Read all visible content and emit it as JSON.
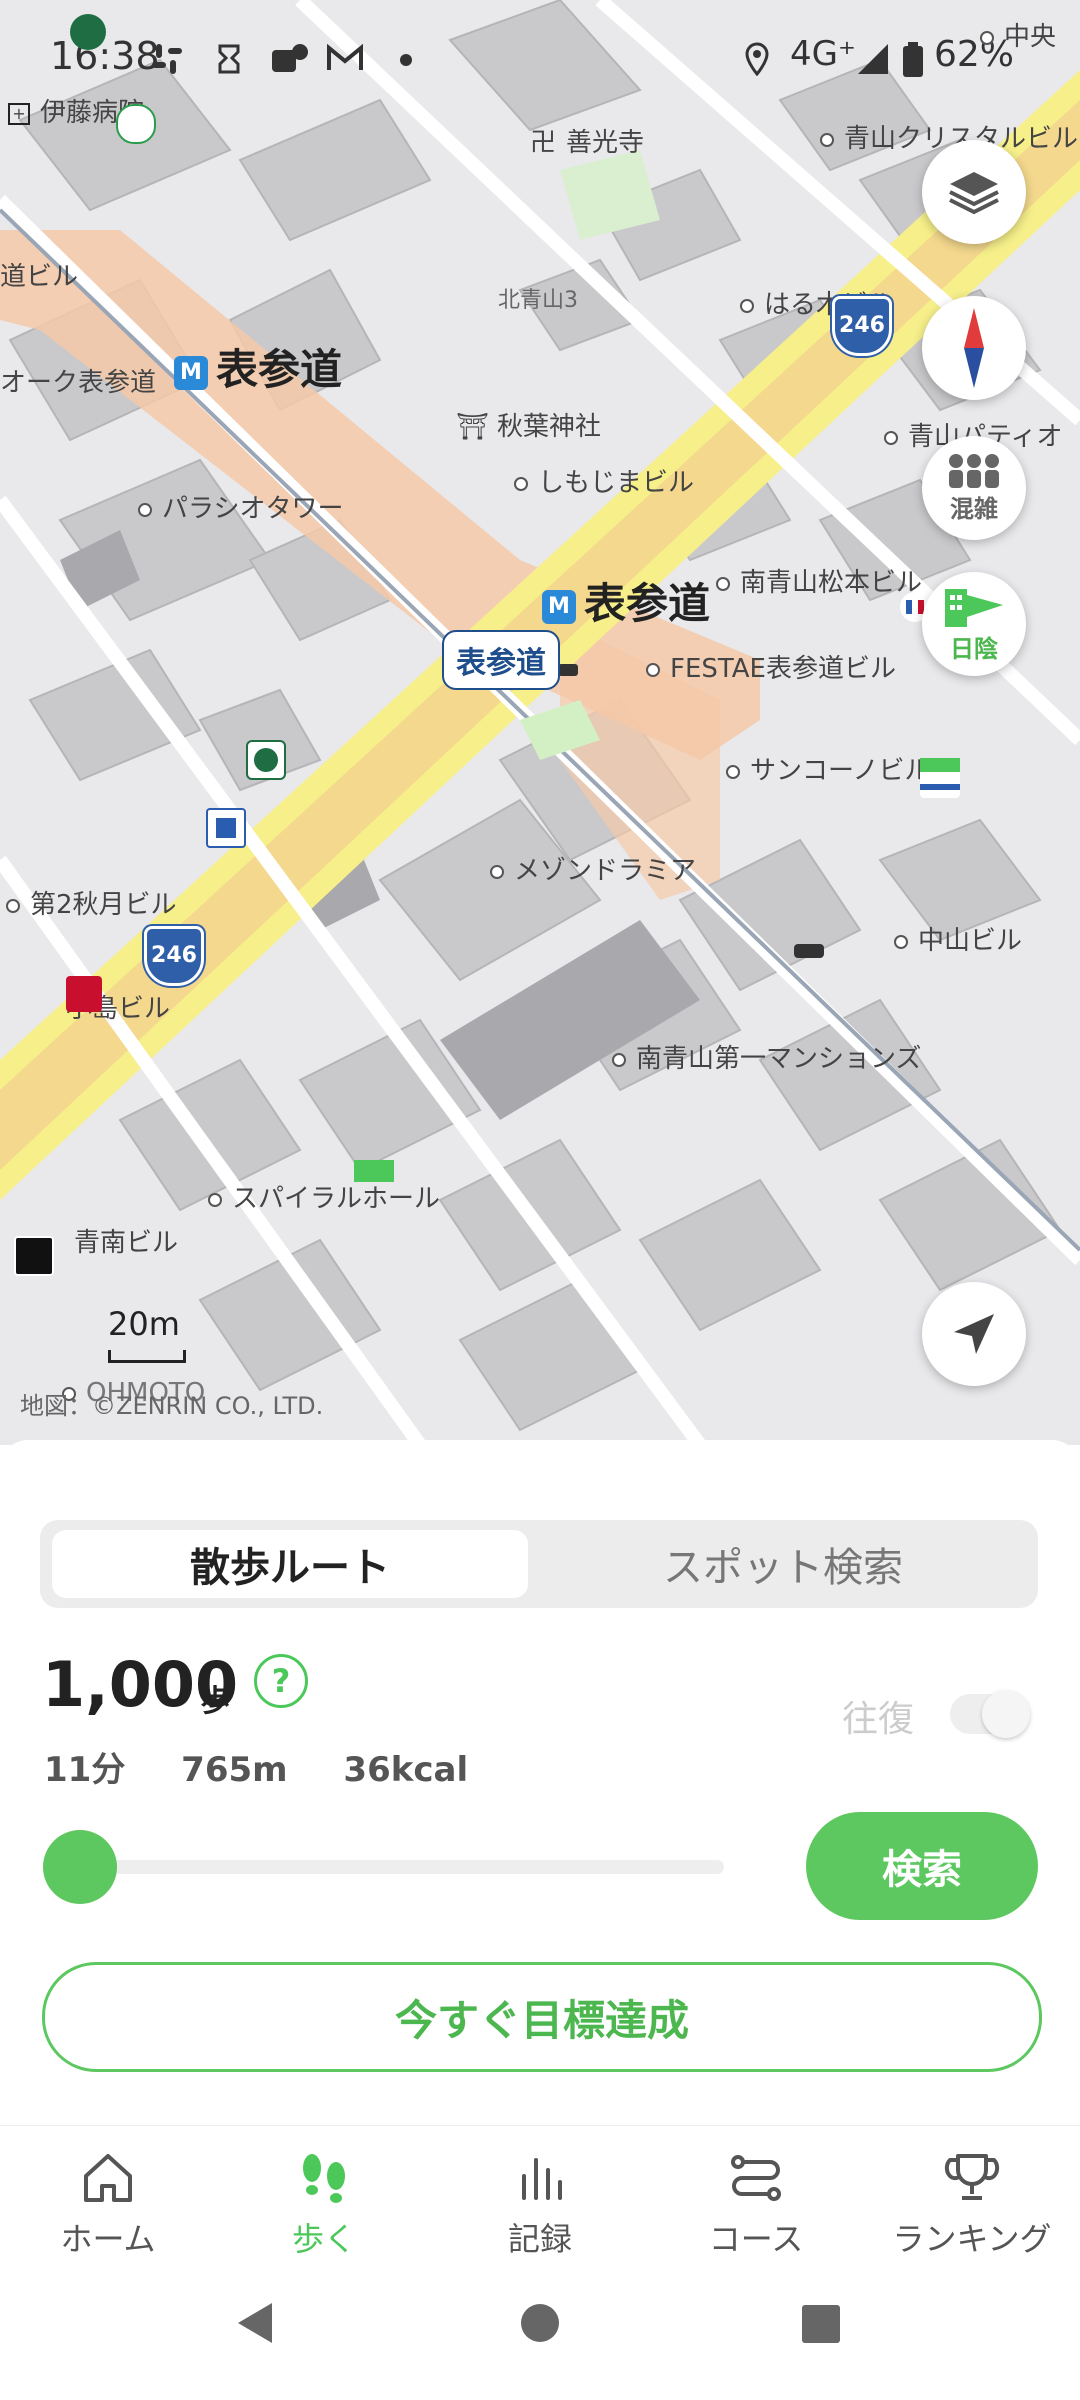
{
  "status_bar": {
    "time": "16:38",
    "network": "4G⁺",
    "battery": "62%"
  },
  "map": {
    "labels": {
      "ito_hospital": "伊藤病院",
      "zenkoji": "善光寺",
      "aoyama_crystal": "青山クリスタルビル",
      "kitaaoyama3": "北青山3",
      "haruki_bldg": "はる木ビル",
      "michi_bldg": "道ビル",
      "oak_omotesando": "オーク表参道",
      "akiba_jinja": "秋葉神社",
      "shimojima_bldg": "しもじまビル",
      "aoyama_patio": "青山パティオ",
      "parashio_tower": "パラシオタワー",
      "minamiaoyama_matsumoto": "南青山松本ビル",
      "festae": "FESTAE表参道ビル",
      "sankono_bldg": "サンコーノビル",
      "maison_dramia": "メゾンドラミア",
      "dai2_akizuki": "第2秋月ビル",
      "nakayama_bldg": "中山ビル",
      "kojima_bldg": "小島ビル",
      "minamiaoyama_mansion": "南青山第一マンションズ",
      "spiral_hall": "スパイラルホール",
      "seinan_bldg": "青南ビル",
      "chuo": "中央",
      "ohmoto": "OHMOTO"
    },
    "station_name": "表参道",
    "station_callout": "表参道",
    "route_shield": "246",
    "scale": "20m",
    "copyright": "地図：©ZENRIN CO., LTD.",
    "buttons": {
      "crowd": "混雑",
      "shade": "日陰"
    }
  },
  "sheet": {
    "tabs": {
      "walk_route": "散歩ルート",
      "spot_search": "スポット検索"
    },
    "steps_value": "1,000",
    "steps_unit": "歩",
    "help": "?",
    "roundtrip_label": "往復",
    "stats": {
      "time": "11分",
      "distance": "765m",
      "calories": "36kcal"
    },
    "slider_fraction": 0.0,
    "search_button": "検索",
    "goal_button": "今すぐ目標達成"
  },
  "bottom_nav": [
    {
      "label": "ホーム",
      "icon": "home-icon"
    },
    {
      "label": "歩く",
      "icon": "footsteps-icon"
    },
    {
      "label": "記録",
      "icon": "bar-chart-icon"
    },
    {
      "label": "コース",
      "icon": "route-icon"
    },
    {
      "label": "ランキング",
      "icon": "trophy-icon"
    }
  ],
  "colors": {
    "accent": "#5cc85f",
    "road_yellow": "#f6ef8a",
    "station_area": "#f5c9a8",
    "map_bg": "#e9e9ec"
  }
}
